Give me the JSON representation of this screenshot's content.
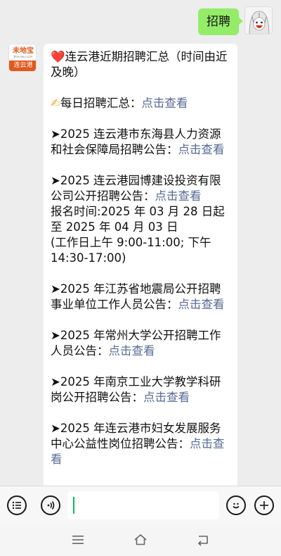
{
  "outgoing": {
    "text": "招聘"
  },
  "bot": {
    "logo_main": "未地宝",
    "logo_sub": "Beeulwu.com",
    "logo_bar": "连云港"
  },
  "message": {
    "heart": "❤️",
    "title": "连云港近期招聘汇总（时间由近及晚）",
    "hand": "✍",
    "daily_label": "每日招聘汇总：",
    "link_text": "点击查看",
    "items": [
      {
        "text": "➤2025 连云港市东海县人力资源和社会保障局招聘公告：",
        "link": "点击查看",
        "extra": ""
      },
      {
        "text": "➤2025 连云港园博建设投资有限公司公开招聘公告：",
        "link": "点击查看",
        "extra": "报名时间:2025 年 03 月 28 日起至 2025 年 04 月 03 日\n(工作日上午 9:00-11:00; 下午 14:30-17:00)"
      },
      {
        "text": "➤2025 年江苏省地震局公开招聘事业单位工作人员公告：",
        "link": "点击查看",
        "extra": ""
      },
      {
        "text": "➤2025 年常州大学公开招聘工作人员公告：",
        "link": "点击查看",
        "extra": ""
      },
      {
        "text": "➤2025 年南京工业大学教学科研岗公开招聘公告：",
        "link": "点击查看",
        "extra": ""
      },
      {
        "text": "➤2025 年连云港市妇女发展服务中心公益性岗位招聘公告：",
        "link": "点击查看",
        "extra": ""
      }
    ]
  },
  "input": {
    "value": "",
    "placeholder": ""
  },
  "icons": {
    "list": "list-icon",
    "voice": "voice-icon",
    "emoji": "emoji-icon",
    "plus": "plus-icon",
    "menu": "nav-menu-icon",
    "home": "nav-home-icon",
    "back": "nav-back-icon"
  },
  "colors": {
    "accent": "#07c160",
    "bubble_out": "#95ec69",
    "link": "#576b95",
    "brand": "#e2571c"
  }
}
